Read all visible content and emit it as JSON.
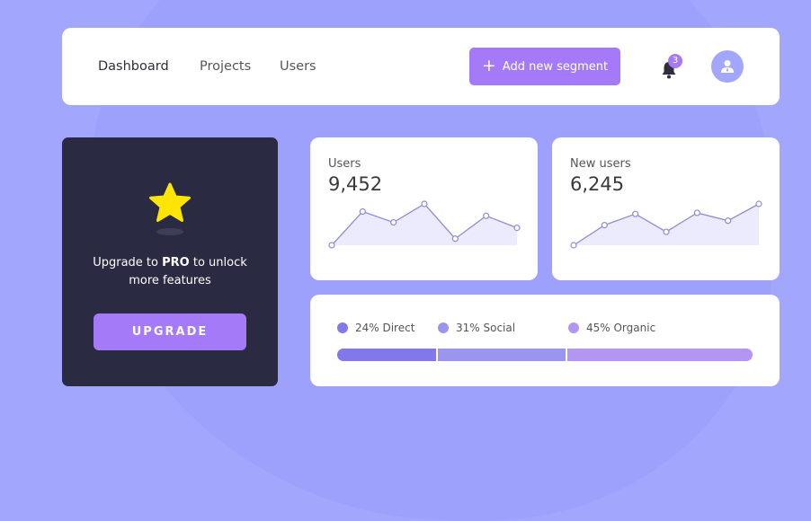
{
  "nav": [
    {
      "label": "Dashboard"
    },
    {
      "label": "Projects"
    },
    {
      "label": "Users"
    }
  ],
  "header": {
    "add_button_label": "Add new segment",
    "notification_count": "3",
    "accent_color": "#a47af8"
  },
  "promo": {
    "text_before": "Upgrade to ",
    "text_bold": "PRO",
    "text_after": " to unlock more features",
    "button_label": "UPGRADE",
    "icon": "star-icon"
  },
  "stats": [
    {
      "label": "Users",
      "value": "9,452",
      "series": [
        0,
        31,
        21,
        38,
        6,
        27,
        16
      ]
    },
    {
      "label": "New users",
      "value": "6,245",
      "series": [
        0,
        18,
        28,
        12,
        29,
        22,
        37
      ]
    }
  ],
  "sources": {
    "items": [
      {
        "label": "24% Direct",
        "percent": 24,
        "color": "#8278ec"
      },
      {
        "label": "31% Social",
        "percent": 31,
        "color": "#9a96f0"
      },
      {
        "label": "45% Organic",
        "percent": 45,
        "color": "#b396f1"
      }
    ]
  }
}
